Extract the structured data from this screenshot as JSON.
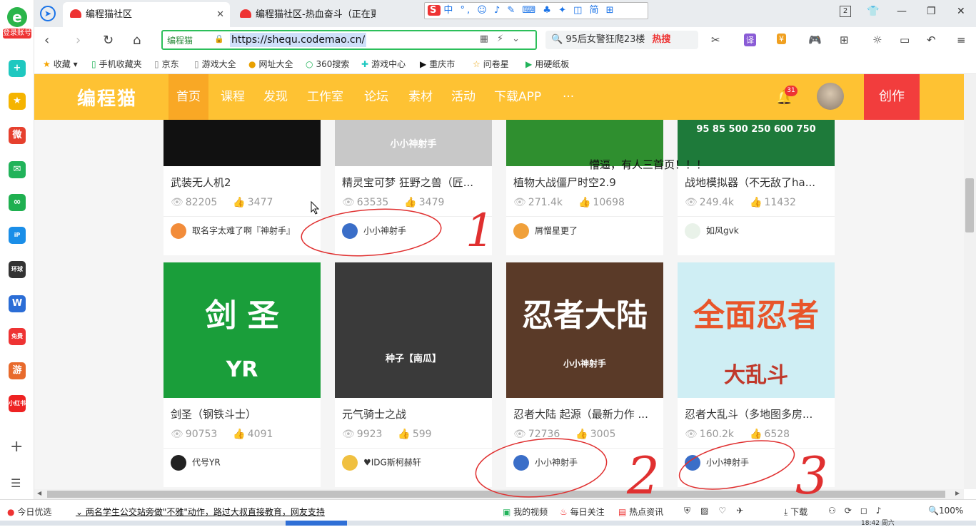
{
  "rail": {
    "login_label": "登录账号",
    "items": [
      {
        "icon": "plus-app-icon",
        "color": "#1fc8c0",
        "text": "+"
      },
      {
        "icon": "star-icon",
        "color": "#f5b400",
        "text": "★"
      },
      {
        "icon": "weibo-icon",
        "color": "#e6402e",
        "text": "微"
      },
      {
        "icon": "mail-icon",
        "color": "#21b35a",
        "text": "✉"
      },
      {
        "icon": "link-icon",
        "color": "#1fb050",
        "text": "∞"
      },
      {
        "icon": "ip-icon",
        "color": "#1a8ee8",
        "text": "iP"
      },
      {
        "icon": "global-icon",
        "color": "#333",
        "text": "环球"
      },
      {
        "icon": "word-icon",
        "color": "#2b6dd6",
        "text": "W"
      },
      {
        "icon": "novel-icon",
        "color": "#e33",
        "text": "免费"
      },
      {
        "icon": "game-icon",
        "color": "#e86a2c",
        "text": "游"
      },
      {
        "icon": "redbook-icon",
        "color": "#e22",
        "text": "小红书"
      }
    ]
  },
  "tabs": [
    {
      "title": "编程猫社区",
      "active": true
    },
    {
      "title": "编程猫社区-热血奋斗（正在更新",
      "active": false
    }
  ],
  "ime_bar": {
    "brand": "S",
    "items": "中 °, ☺ ♪ ✎ ⌨ ♣ ✦ ◫ 简 ⊞"
  },
  "window_controls": {
    "count": "2"
  },
  "toolbar": {
    "site_label": "编程猫",
    "url": "https://shequ.codemao.cn/",
    "search_text": "95后女警狂爬23楼",
    "search_hot": "热搜"
  },
  "bookmarks": [
    {
      "label": "收藏"
    },
    {
      "label": "手机收藏夹"
    },
    {
      "label": "京东"
    },
    {
      "label": "游戏大全"
    },
    {
      "label": "网址大全"
    },
    {
      "label": "360搜索"
    },
    {
      "label": "游戏中心"
    },
    {
      "label": "重庆市"
    },
    {
      "label": "问卷星"
    },
    {
      "label": "用硬纸板"
    }
  ],
  "site": {
    "logo": "编程猫",
    "nav": [
      "首页",
      "课程",
      "发现",
      "工作室",
      "论坛",
      "素材",
      "活动",
      "下载APP",
      "···"
    ],
    "notification_count": "31",
    "create_label": "创作"
  },
  "note_text": "懵逼，有人三首页！！！",
  "cards": [
    {
      "title": "武装无人机2",
      "views": "82205",
      "likes": "3477",
      "author": "取名字太难了啊『神射手』",
      "thumb_color": "#111",
      "avatar_color": "#f28c3a"
    },
    {
      "title": "精灵宝可梦 狂野之兽（匠...",
      "views": "63535",
      "likes": "3479",
      "author": "小小神射手",
      "thumb_color": "#c8c8c8",
      "avatar_color": "#3a6ec8",
      "thumb_text": "小小神射手"
    },
    {
      "title": "植物大战僵尸时空2.9",
      "views": "271.4k",
      "likes": "10698",
      "author": "屑憎星更了",
      "thumb_color": "#2f8f2f",
      "avatar_color": "#f0a03a"
    },
    {
      "title": "战地模拟器（不无敌了ha...",
      "views": "249.4k",
      "likes": "11432",
      "author": "如风gvk",
      "thumb_color": "#1e7a3a",
      "avatar_color": "#e9f2e9",
      "thumb_text": "95 85 500 250 600 750"
    },
    {
      "title": "剑圣（钢铁斗士）",
      "views": "90753",
      "likes": "4091",
      "author": "代号YR",
      "thumb_color": "#1a9e3a",
      "avatar_color": "#222",
      "thumb_text": "剑 圣",
      "thumb_small": "YR"
    },
    {
      "title": "元气骑士之战",
      "views": "9923",
      "likes": "599",
      "author": "♥IDG斯柯赫轩",
      "thumb_color": "#3a3a3a",
      "avatar_color": "#f0c040",
      "thumb_text": "种子【南瓜】"
    },
    {
      "title": "忍者大陆 起源（最新力作 ...",
      "views": "72736",
      "likes": "3005",
      "author": "小小神射手",
      "thumb_color": "#5a3a28",
      "avatar_color": "#3a6ec8",
      "thumb_text": "忍者大陆",
      "thumb_small": "小小神射手"
    },
    {
      "title": "忍者大乱斗（多地图多房...",
      "views": "160.2k",
      "likes": "6528",
      "author": "小小神射手",
      "thumb_color": "#cfeef4",
      "avatar_color": "#3a6ec8",
      "thumb_text": "全面忍者",
      "thumb_small": "大乱斗"
    }
  ],
  "status": {
    "today": "今日优选",
    "news": "两名学生公交站旁做\"不雅\"动作，路过大叔直接教育，网友支持",
    "video": "我的视频",
    "daily": "每日关注",
    "hot": "热点资讯",
    "download": "下载",
    "zoom": "100%",
    "clock": "18:42 周六"
  },
  "annotations": [
    "1",
    "2",
    "3"
  ]
}
